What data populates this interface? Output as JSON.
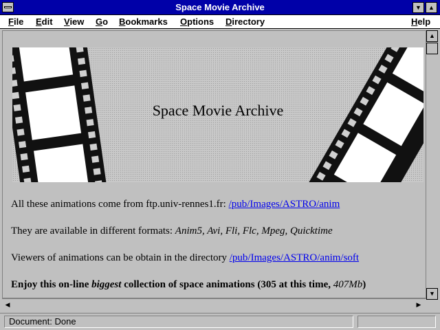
{
  "window": {
    "title": "Space Movie Archive"
  },
  "menubar": {
    "items": [
      {
        "label": "File"
      },
      {
        "label": "Edit"
      },
      {
        "label": "View"
      },
      {
        "label": "Go"
      },
      {
        "label": "Bookmarks"
      },
      {
        "label": "Options"
      },
      {
        "label": "Directory"
      }
    ],
    "help": "Help"
  },
  "page": {
    "banner_title": "Space Movie Archive",
    "line1": {
      "text": "All these animations come from ftp.univ-rennes1.fr: ",
      "link": "/pub/Images/ASTRO/anim"
    },
    "line2": {
      "text": "They are available in different formats: ",
      "formats": "Anim5, Avi, Fli, Flc, Mpeg, Quicktime"
    },
    "line3": {
      "text": "Viewers of animations can be obtain in the directory ",
      "link": "/pub/Images/ASTRO/anim/soft"
    },
    "line4": {
      "a": "Enjoy this on-line ",
      "b": "biggest",
      "c": " collection of space animations (305 at this time, ",
      "d": "407Mb",
      "e": ")"
    }
  },
  "status": {
    "text": "Document: Done"
  },
  "icons": {
    "system_menu": "system-menu-icon",
    "minimize": "minimize-icon",
    "maximize": "maximize-icon",
    "scroll_up": "scroll-up-icon",
    "scroll_down": "scroll-down-icon",
    "scroll_left": "scroll-left-icon",
    "scroll_right": "scroll-right-icon"
  }
}
